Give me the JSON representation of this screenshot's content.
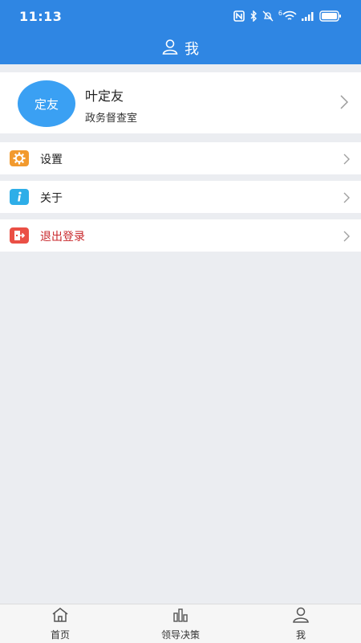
{
  "status": {
    "time": "11:13",
    "network": "6"
  },
  "header": {
    "title": "我",
    "icon": "user-icon"
  },
  "profile": {
    "avatar_text": "定友",
    "name": "叶定友",
    "department": "政务督查室"
  },
  "menu": [
    {
      "label": "设置",
      "icon": "gear-icon",
      "color": "#f29a2e"
    },
    {
      "label": "关于",
      "icon": "info-icon",
      "color": "#2eaee8"
    },
    {
      "label": "退出登录",
      "icon": "logout-icon",
      "color": "#ea4f45",
      "text_color": "#c8282c"
    }
  ],
  "tabs": [
    {
      "label": "首页",
      "icon": "home-icon"
    },
    {
      "label": "领导决策",
      "icon": "bar-chart-icon"
    },
    {
      "label": "我",
      "icon": "user-icon"
    }
  ],
  "colors": {
    "primary": "#2f86e3",
    "background": "#ebedf1",
    "avatar": "#3aa0f3"
  }
}
